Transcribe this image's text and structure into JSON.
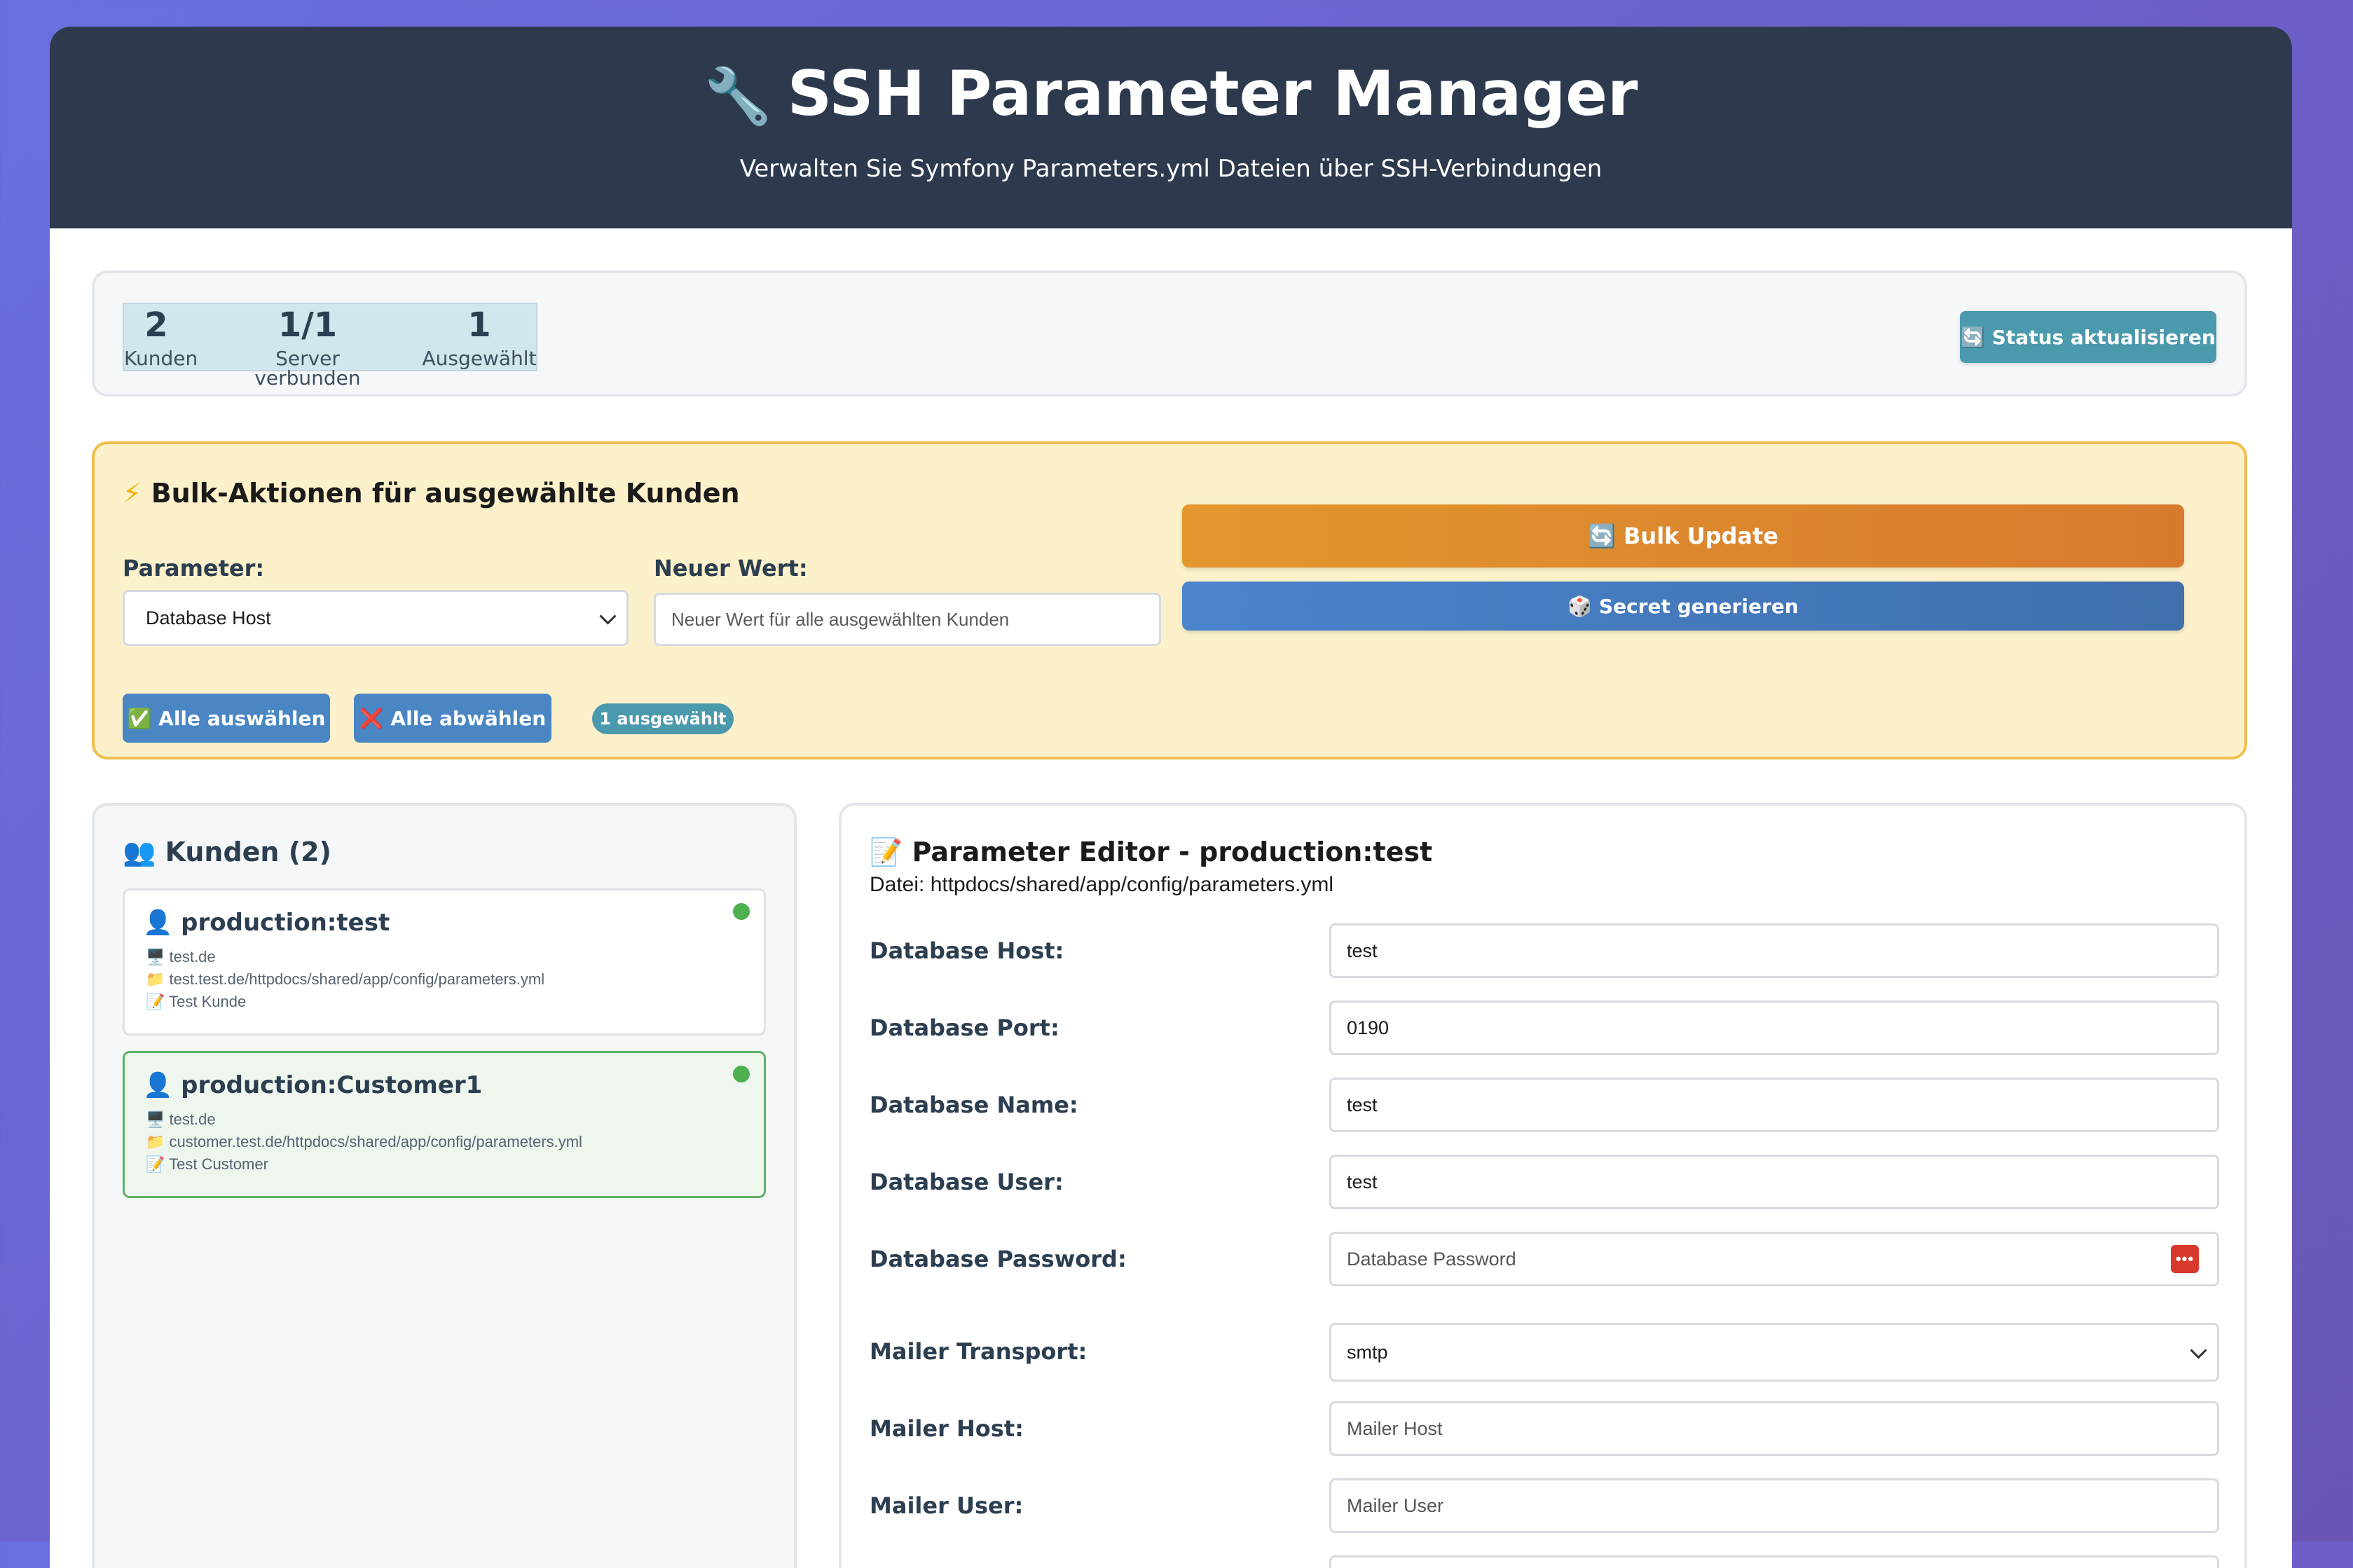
{
  "header": {
    "icon": "wrench-icon",
    "icon_glyph": "🔧",
    "title": "SSH Parameter Manager",
    "subtitle": "Verwalten Sie Symfony Parameters.yml Dateien über SSH-Verbindungen"
  },
  "stats": {
    "kunden_value": "2",
    "kunden_label": "Kunden",
    "server_value": "1/1",
    "server_label": "Server verbunden",
    "selected_value": "1",
    "selected_label": "Ausgewählt",
    "refresh_button": "🔄 Status aktualisieren"
  },
  "bulk": {
    "title_icon": "⚡",
    "title": "Bulk-Aktionen für ausgewählte Kunden",
    "param_label": "Parameter:",
    "param_selected": "Database Host",
    "value_label": "Neuer Wert:",
    "value_placeholder": "Neuer Wert für alle ausgewählten Kunden",
    "bulk_update_button": "🔄 Bulk Update",
    "secret_button": "🎲 Secret generieren",
    "select_all_button": "✅ Alle auswählen",
    "deselect_all_button": "❌ Alle abwählen",
    "selected_badge": "1 ausgewählt"
  },
  "kunden": {
    "title_icon": "👥",
    "title": "Kunden (2)",
    "items": [
      {
        "name": "production:test",
        "host": "test.de",
        "path": "test.test.de/httpdocs/shared/app/config/parameters.yml",
        "description": "Test Kunde",
        "status_color": "#4caf50",
        "selected": false
      },
      {
        "name": "production:Customer1",
        "host": "test.de",
        "path": "customer.test.de/httpdocs/shared/app/config/parameters.yml",
        "description": "Test Customer",
        "status_color": "#4caf50",
        "selected": true
      }
    ]
  },
  "editor": {
    "title_icon": "📝",
    "title": "Parameter Editor - production:test",
    "file_line": "Datei: httpdocs/shared/app/config/parameters.yml",
    "params": [
      {
        "label": "Database Host:",
        "value": "test",
        "placeholder": ""
      },
      {
        "label": "Database Port:",
        "value": "0190",
        "placeholder": ""
      },
      {
        "label": "Database Name:",
        "value": "test",
        "placeholder": ""
      },
      {
        "label": "Database User:",
        "value": "test",
        "placeholder": ""
      },
      {
        "label": "Database Password:",
        "value": "",
        "placeholder": "Database Password"
      },
      {
        "label": "Mailer Transport:",
        "value": "smtp",
        "placeholder": ""
      },
      {
        "label": "Mailer Host:",
        "value": "",
        "placeholder": "Mailer Host"
      },
      {
        "label": "Mailer User:",
        "value": "",
        "placeholder": "Mailer User"
      }
    ]
  },
  "colors": {
    "header_bg": "#2d3a4e",
    "bulk_bg": "#fcf1ca",
    "bulk_border": "#f1bd4c",
    "accent_teal": "#4a99ad",
    "accent_blue": "#4a86c4",
    "accent_orange": "#e3972e",
    "status_green": "#4caf50"
  }
}
